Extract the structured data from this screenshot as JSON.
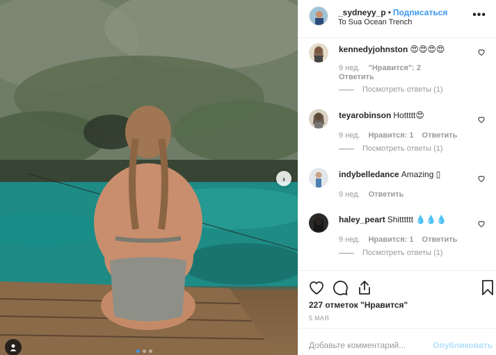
{
  "post": {
    "username": "_sydneyy_p",
    "follow_label": "Подписаться",
    "location": "To Sua Ocean Trench",
    "more_label": "•••",
    "carousel_pages": 3,
    "active_page": 1
  },
  "comments": [
    {
      "username": "kennedyjohnston",
      "text": "😍😍😍😍",
      "time": "9 нед.",
      "likes": "\"Нравится\": 2",
      "reply": "Ответить",
      "view_replies": "Посмотреть ответы (1)"
    },
    {
      "username": "teyarobinson",
      "text": "Hottttt😍",
      "time": "9 нед.",
      "likes": "Нравится: 1",
      "reply": "Ответить",
      "view_replies": "Посмотреть ответы (1)"
    },
    {
      "username": "indybelledance",
      "text": "Amazing ▯",
      "time": "9 нед.",
      "reply": "Ответить"
    },
    {
      "username": "haley_peart",
      "text": "Shitttttt 💧💧💧",
      "time": "9 нед.",
      "likes": "Нравится: 1",
      "reply": "Ответить",
      "view_replies": "Посмотреть ответы (1)"
    }
  ],
  "footer": {
    "likes_count": "227 отметок \"Нравится\"",
    "date": "5 МАЯ",
    "comment_placeholder": "Добавьте комментарий...",
    "post_label": "Опубликовать"
  },
  "icons": [
    "heart-icon",
    "comment-icon",
    "share-icon",
    "bookmark-icon",
    "chevron-right-icon",
    "user-tag-icon"
  ],
  "colors": {
    "link": "#3897f0",
    "muted": "#999999",
    "disabled": "#b2dffc"
  }
}
